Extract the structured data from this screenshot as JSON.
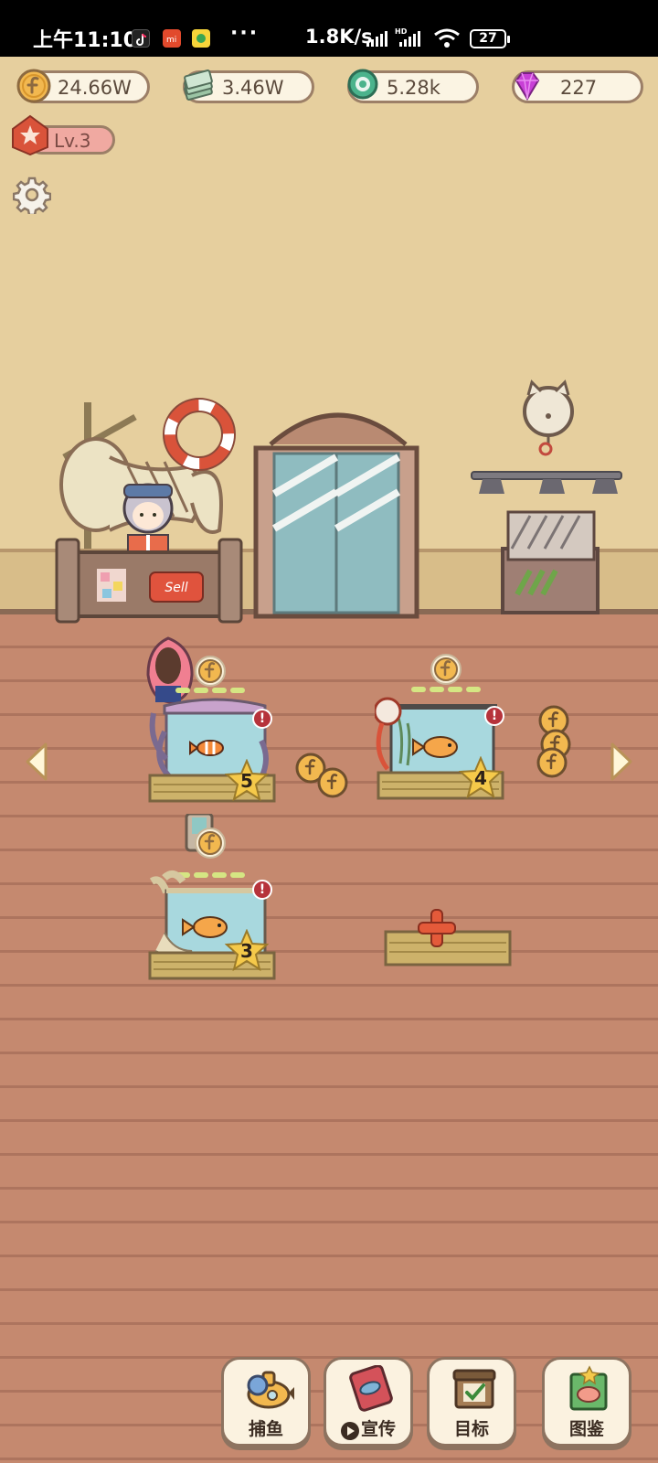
{
  "status_bar": {
    "time": "上午11:10",
    "more": "···",
    "net_speed": "1.8K/s",
    "battery": "27"
  },
  "hud": {
    "coins": "24.66W",
    "cash": "3.46W",
    "shells": "5.28k",
    "gems": "227",
    "level": "Lv.3"
  },
  "shop": {
    "counter_sign": "Sell"
  },
  "tanks": [
    {
      "stars": "5",
      "fish_icon": "clownfish-icon",
      "alert": "!"
    },
    {
      "stars": "4",
      "fish_icon": "goldfish-icon",
      "alert": "!"
    },
    {
      "stars": "3",
      "fish_icon": "goldfish-icon",
      "alert": "!"
    }
  ],
  "nav": {
    "catch": "捕鱼",
    "promote": "宣传",
    "goals": "目标",
    "collection": "图鉴"
  },
  "colors": {
    "wall": "#e6cf9e",
    "floor": "#c5896f",
    "coin": "#f2b84f",
    "gem": "#c83fd6",
    "accent_red": "#d9533a"
  }
}
